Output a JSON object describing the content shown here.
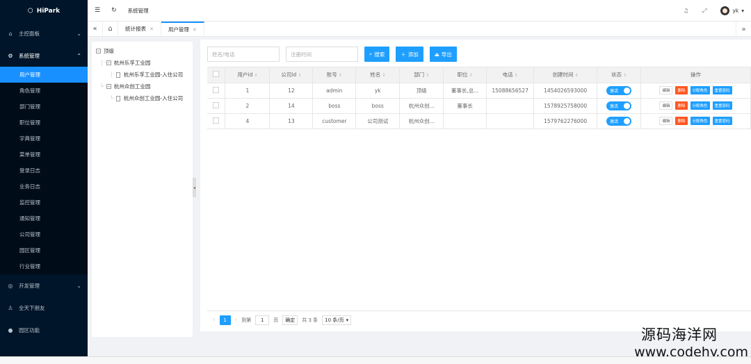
{
  "app": {
    "title": "HiPark"
  },
  "sidebar": {
    "items": [
      {
        "label": "主控面板",
        "icon": "home-icon"
      },
      {
        "label": "系统管理",
        "icon": "gear-icon"
      }
    ],
    "sub_items": [
      "用户管理",
      "角色管理",
      "部门管理",
      "职位管理",
      "字典管理",
      "菜单管理",
      "登录日志",
      "业务日志",
      "监控管理",
      "通知管理",
      "公司管理",
      "园区管理",
      "行业管理"
    ],
    "bottom_items": [
      {
        "label": "开发管理",
        "icon": "dev-icon"
      },
      {
        "label": "全天下朋友",
        "icon": "friends-icon"
      },
      {
        "label": "园区功能",
        "icon": "park-icon"
      }
    ]
  },
  "header": {
    "breadcrumb": "系统管理",
    "user": "yk"
  },
  "tabs": [
    {
      "label": "统计报表"
    },
    {
      "label": "用户管理"
    }
  ],
  "tree": {
    "root": "顶级",
    "nodes": [
      {
        "label": "杭州乐孚工业园",
        "child": "杭州乐孚工业园-入住公司"
      },
      {
        "label": "杭州众创工业园",
        "child": "杭州众创工业园-入住公司"
      }
    ]
  },
  "toolbar": {
    "name_placeholder": "姓名/电话",
    "time_placeholder": "注册时间",
    "search_label": "搜索",
    "add_label": "添加",
    "export_label": "导出"
  },
  "table": {
    "columns": [
      "用户id",
      "公司id",
      "账号",
      "姓名",
      "部门",
      "职位",
      "电话",
      "创建时间",
      "状态",
      "操作"
    ],
    "rows": [
      {
        "uid": "1",
        "cid": "12",
        "account": "admin",
        "name": "yk",
        "dept": "顶级",
        "position": "董事长,总...",
        "phone": "15088656527",
        "created": "1454026593000",
        "status": "激活"
      },
      {
        "uid": "2",
        "cid": "14",
        "account": "boss",
        "name": "boss",
        "dept": "杭州众创...",
        "position": "董事长",
        "phone": "",
        "created": "1578925758000",
        "status": "激活"
      },
      {
        "uid": "4",
        "cid": "13",
        "account": "customer",
        "name": "公司测试",
        "dept": "杭州众创...",
        "position": "",
        "phone": "",
        "created": "1579762276000",
        "status": "激活"
      }
    ],
    "ops": {
      "edit": "编辑",
      "delete": "删除",
      "assign_role": "分配角色",
      "reset_pwd": "重置密码"
    }
  },
  "pager": {
    "current": "1",
    "goto_label": "到第",
    "goto_value": "1",
    "page_unit": "页",
    "confirm": "确定",
    "total": "共 3 条",
    "page_size": "10 条/页"
  },
  "watermark": {
    "line1": "源码海洋网",
    "line2": "www.codehy.com"
  }
}
